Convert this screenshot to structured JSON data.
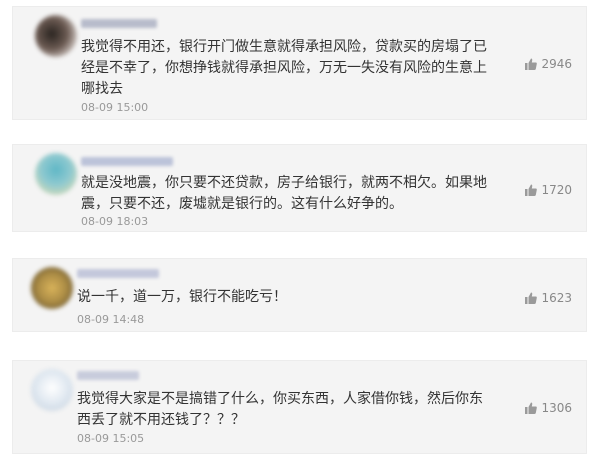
{
  "comments": [
    {
      "lines": [
        "我觉得不用还，银行开门做生意就得承担风险，贷款买的房塌了已",
        "经是不幸了，你想挣钱就得承担风险，万无一失没有风险的生意上",
        "哪找去"
      ],
      "time": "08-09 15:00",
      "likes": "2946",
      "avatar_color": "#6b5a52",
      "username_color": "#b8bccb"
    },
    {
      "lines": [
        "就是没地震，你只要不还贷款，房子给银行，就两不相欠。如果地",
        "震，只要不还，废墟就是银行的。这有什么好争的。"
      ],
      "time": "08-09 18:03",
      "likes": "1720",
      "avatar_color": "#8ec9d0",
      "username_color": "#bcc3d9"
    },
    {
      "lines": [
        "说一千，道一万，银行不能吃亏！"
      ],
      "time": "08-09 14:48",
      "likes": "1623",
      "avatar_color": "#a98a44",
      "username_color": "#c4c8db"
    },
    {
      "lines": [
        "我觉得大家是不是搞错了什么，你买东西，人家借你钱，然后你东",
        "西丢了就不用还钱了？？？"
      ],
      "time": "08-09 15:05",
      "likes": "1306",
      "avatar_color": "#dde6ef",
      "username_color": "#c8ccdc"
    }
  ]
}
